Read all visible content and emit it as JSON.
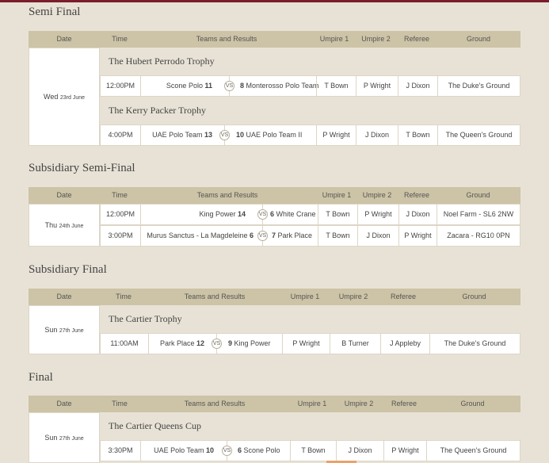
{
  "colors": {
    "accent": "#7b1d2c",
    "header_bg": "#cdc3a6",
    "page_bg": "#e8e2d6"
  },
  "headers": {
    "date": "Date",
    "time": "Time",
    "teams": "Teams and Results",
    "umpire1": "Umpire 1",
    "umpire2": "Umpire 2",
    "referee": "Referee",
    "ground": "Ground"
  },
  "vs_label": "VS",
  "sections": [
    {
      "title": "Semi Final",
      "date_day": "Wed",
      "date_num": "23rd June",
      "matches": [
        {
          "trophy": "The Hubert Perrodo Trophy",
          "time": "12:00PM",
          "team1": "Scone Polo",
          "score1": "11",
          "score2": "8",
          "team2": "Monterosso Polo Team",
          "umpire1": "T Bown",
          "umpire2": "P Wright",
          "referee": "J Dixon",
          "ground": "The Duke's Ground"
        },
        {
          "trophy": "The Kerry Packer Trophy",
          "time": "4:00PM",
          "team1": "UAE Polo Team",
          "score1": "13",
          "score2": "10",
          "team2": "UAE Polo Team II",
          "umpire1": "P Wright",
          "umpire2": "J Dixon",
          "referee": "T Bown",
          "ground": "The Queen's Ground"
        }
      ]
    },
    {
      "title": "Subsidiary Semi-Final",
      "date_day": "Thu",
      "date_num": "24th June",
      "matches": [
        {
          "time": "12:00PM",
          "team1": "King Power",
          "score1": "14",
          "score2": "6",
          "team2": "White Crane",
          "umpire1": "T Bown",
          "umpire2": "P Wright",
          "referee": "J Dixon",
          "ground": "Noel Farm - SL6 2NW"
        },
        {
          "time": "3:00PM",
          "team1": "Murus Sanctus - La Magdeleine",
          "score1": "6",
          "score2": "7",
          "team2": "Park Place",
          "umpire1": "T Bown",
          "umpire2": "J Dixon",
          "referee": "P Wright",
          "ground": "Zacara - RG10 0PN"
        }
      ]
    },
    {
      "title": "Subsidiary Final",
      "date_day": "Sun",
      "date_num": "27th June",
      "matches": [
        {
          "trophy": "The Cartier Trophy",
          "time": "11:00AM",
          "team1": "Park Place",
          "score1": "12",
          "score2": "9",
          "team2": "King Power",
          "umpire1": "P Wright",
          "umpire2": "B Turner",
          "referee": "J Appleby",
          "ground": "The Duke's Ground"
        }
      ]
    },
    {
      "title": "Final",
      "date_day": "Sun",
      "date_num": "27th June",
      "matches": [
        {
          "trophy": "The Cartier Queens Cup",
          "time": "3:30PM",
          "team1": "UAE Polo Team",
          "score1": "10",
          "score2": "6",
          "team2": "Scone Polo",
          "umpire1": "T Bown",
          "umpire2": "J Dixon",
          "referee": "P Wright",
          "ground": "The Queen's Ground"
        }
      ]
    }
  ]
}
